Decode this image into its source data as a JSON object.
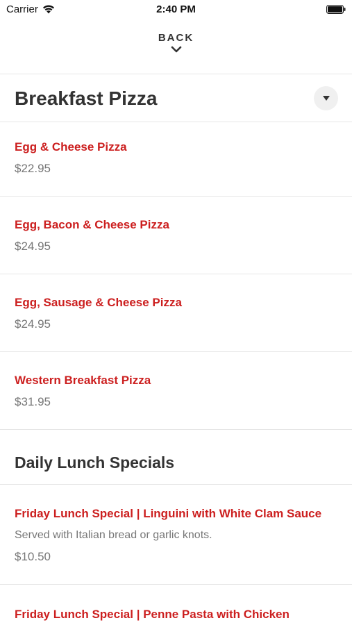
{
  "status_bar": {
    "carrier": "Carrier",
    "time": "2:40 PM"
  },
  "nav": {
    "back_label": "BACK"
  },
  "category": {
    "title": "Breakfast Pizza",
    "items": [
      {
        "name": "Egg & Cheese Pizza",
        "price": "$22.95"
      },
      {
        "name": "Egg, Bacon & Cheese Pizza",
        "price": "$24.95"
      },
      {
        "name": "Egg, Sausage & Cheese Pizza",
        "price": "$24.95"
      },
      {
        "name": "Western Breakfast Pizza",
        "price": "$31.95"
      }
    ]
  },
  "lunch_section": {
    "title": "Daily Lunch Specials",
    "items": [
      {
        "name": "Friday Lunch Special | Linguini with White Clam Sauce",
        "description": "Served with Italian bread or garlic knots.",
        "price": "$10.50"
      },
      {
        "name": "Friday Lunch Special | Penne Pasta with Chicken"
      }
    ]
  },
  "colors": {
    "accent": "#cc1f1f",
    "muted_text": "#777777",
    "divider": "#e6e6e6"
  }
}
